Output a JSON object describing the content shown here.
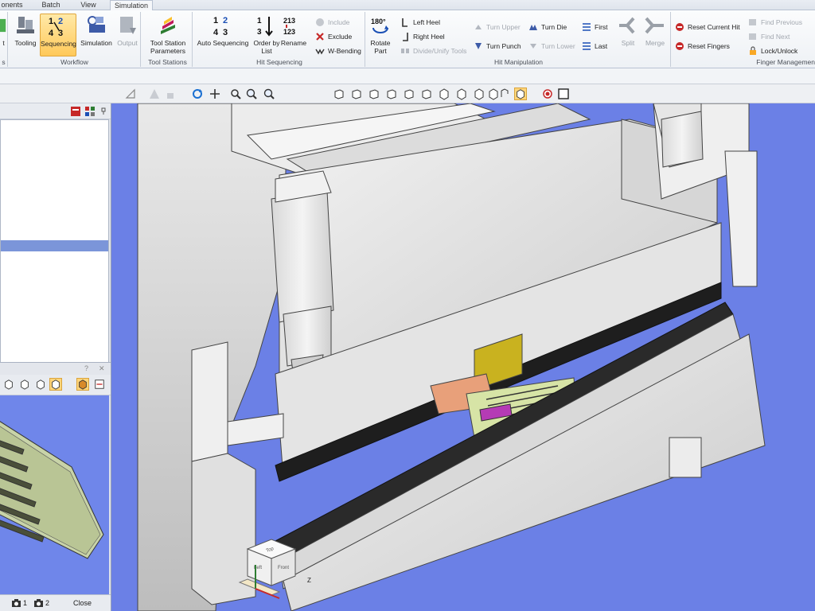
{
  "tabs": [
    "onents",
    "Batch",
    "View",
    "Simulation"
  ],
  "ribbon": {
    "workflow": {
      "label": "Workflow",
      "buttons": [
        "Tooling",
        "Sequencing",
        "Simulation",
        "Output"
      ],
      "partial_label": "t"
    },
    "tool_stations": {
      "label": "Tool Stations",
      "button": "Tool Station Parameters"
    },
    "hit_sequencing": {
      "label": "Hit Sequencing",
      "big": [
        "Auto Sequencing",
        "Order by List",
        "Rename"
      ],
      "small": [
        "Include",
        "Exclude",
        "W-Bending"
      ]
    },
    "hit_manipulation": {
      "label": "Hit Manipulation",
      "big": [
        "Rotate Part"
      ],
      "small": [
        "Left Heel",
        "Right Heel",
        "Divide/Unify Tools",
        "Turn Upper",
        "Turn Punch",
        "Turn Die",
        "Turn Lower",
        "First",
        "Last"
      ],
      "big2": [
        "Split",
        "Merge"
      ]
    },
    "finger_management": {
      "label": "Finger Managemen",
      "small": [
        "Reset Current Hit",
        "Reset Fingers",
        "Find Previous",
        "Find Next",
        "Lock/Unlock"
      ]
    },
    "left_group_label": "s"
  },
  "left_panel": {
    "pane2_controls": [
      "?",
      "✕"
    ],
    "footer": {
      "cam1": "1",
      "cam2": "2",
      "close": "Close"
    }
  },
  "navcube": {
    "top": "Top",
    "left": "Left",
    "front": "Front",
    "z_axis": "Z"
  },
  "colors": {
    "viewport_bg": "#6b80e6",
    "selection": "#ffc95a"
  }
}
